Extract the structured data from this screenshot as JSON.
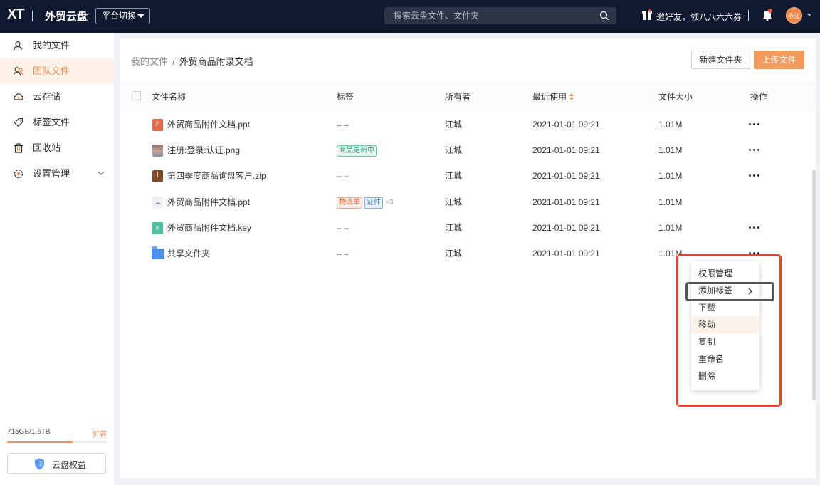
{
  "header": {
    "logo": "XT",
    "app_name": "外贸云盘",
    "platform_switch": "平台切换",
    "search_placeholder": "搜索云盘文件、文件夹",
    "invite_text": "邀好友，领八八六六券",
    "avatar_text": "寺江"
  },
  "sidebar": {
    "items": [
      {
        "label": "我的文件",
        "icon": "user-file-icon",
        "active": false
      },
      {
        "label": "团队文件",
        "icon": "team-file-icon",
        "active": true
      },
      {
        "label": "云存储",
        "icon": "cloud-icon",
        "active": false
      },
      {
        "label": "标签文件",
        "icon": "tag-icon",
        "active": false
      },
      {
        "label": "回收站",
        "icon": "trash-icon",
        "active": false
      },
      {
        "label": "设置管理",
        "icon": "settings-icon",
        "active": false
      }
    ],
    "storage_text": "715GB/1.6TB",
    "storage_fraction": 0.66,
    "expand_label": "扩容",
    "benefit_label": "云盘权益"
  },
  "main": {
    "breadcrumb_root": "我的文件",
    "breadcrumb_separator": "/",
    "breadcrumb_current": "外贸商品附录文档",
    "new_folder_label": "新建文件夹",
    "upload_label": "上传文件",
    "columns": {
      "name": "文件名称",
      "tags": "标签",
      "owner": "所有者",
      "recent": "最近使用",
      "size": "文件大小",
      "actions": "操作"
    },
    "rows": [
      {
        "icon": "ppt-file-icon",
        "name": "外贸商品附件文档.ppt",
        "tags_text": "– –",
        "owner": "江城",
        "recent": "2021-01-01 09:21",
        "size": "1.01M"
      },
      {
        "icon": "image-file-icon",
        "name": "注册:登录:认证.png",
        "tags": [
          "商品更新中"
        ],
        "owner": "江城",
        "recent": "2021-01-01 09:21",
        "size": "1.01M"
      },
      {
        "icon": "zip-file-icon",
        "name": "第四季度商品询盘客户.zip",
        "tags_text": "– –",
        "owner": "江城",
        "recent": "2021-01-01 09:21",
        "size": "1.01M"
      },
      {
        "icon": "cloud-file-icon",
        "name": "外贸商品附件文档.ppt",
        "tags": [
          "物流单",
          "证件"
        ],
        "tags_more": "+3",
        "owner": "江城",
        "recent": "2021-01-01 09:21",
        "size": "1.01M"
      },
      {
        "icon": "key-file-icon",
        "name": "外贸商品附件文档.key",
        "tags_text": "– –",
        "owner": "江城",
        "recent": "2021-01-01 09:21",
        "size": "1.01M"
      },
      {
        "icon": "folder-icon",
        "name": "共享文件夹",
        "tags_text": "– –",
        "owner": "江城",
        "recent": "2021-01-01 09:21",
        "size": "1.01M"
      }
    ]
  },
  "context_menu": {
    "items": [
      "权限管理",
      "添加标签",
      "下载",
      "移动",
      "复制",
      "重命名",
      "删除"
    ],
    "submenu_item": "添加标签",
    "hover_item": "移动"
  },
  "colors": {
    "topbar": "#0f1a30",
    "accent": "#f08a4b",
    "highlight_red": "#e64530",
    "highlight_gray": "#555555"
  }
}
